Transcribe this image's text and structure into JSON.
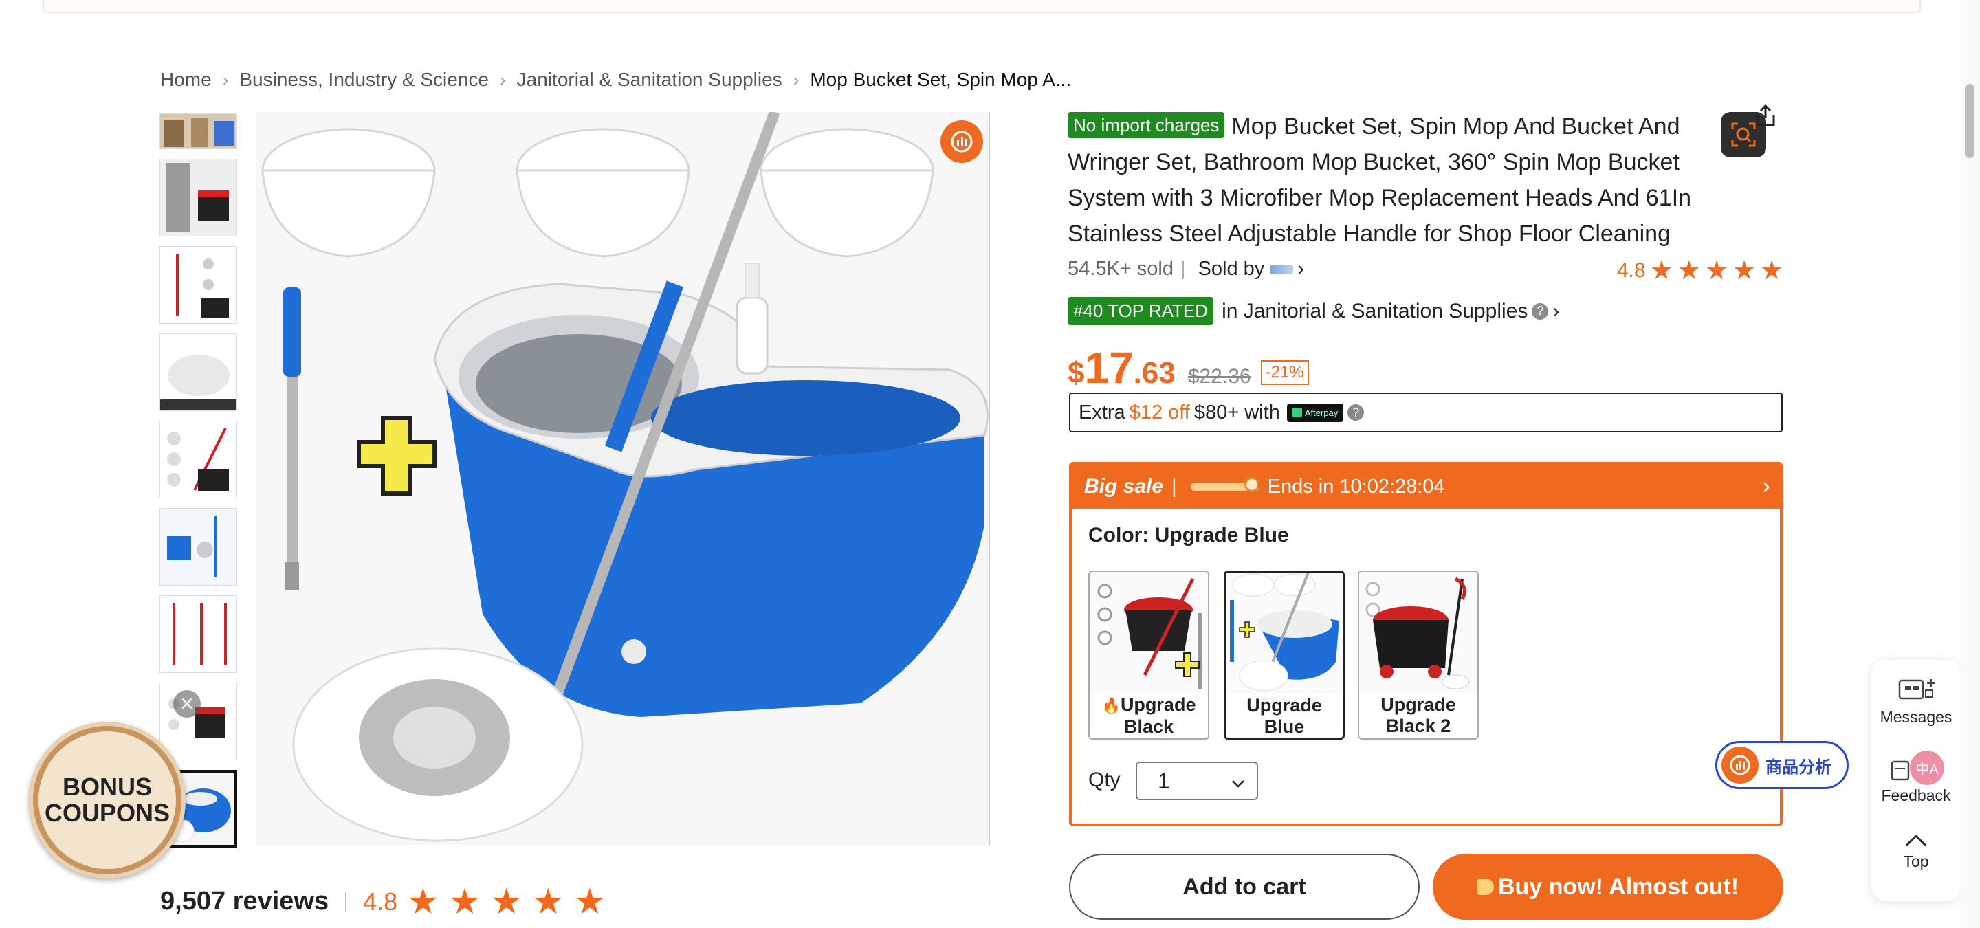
{
  "breadcrumb": [
    {
      "label": "Home"
    },
    {
      "label": "Business, Industry & Science"
    },
    {
      "label": "Janitorial & Sanitation Supplies"
    },
    {
      "label": "Mop Bucket Set, Spin Mop A..."
    }
  ],
  "product": {
    "badge_no_import": "No import charges",
    "title": "Mop Bucket Set, Spin Mop And Bucket And Wringer Set, Bathroom Mop Bucket, 360° Spin Mop Bucket System with 3 Microfiber Mop Replacement Heads And 61In Stainless Steel Adjustable Handle for Shop Floor Cleaning",
    "sold": "54.5K+ sold",
    "sold_by_label": "Sold by",
    "rating": "4.8",
    "top_rated_badge": "#40 TOP RATED",
    "top_rated_category": "in Janitorial & Sanitation Supplies",
    "price": {
      "currency": "$",
      "integer": "17",
      "decimal": ".63",
      "original": "$22.36",
      "discount": "-21%"
    },
    "afterpay": {
      "extra": "Extra",
      "amount": "$12 off",
      "threshold": "$80+ with",
      "logo_text": "Afterpay"
    },
    "sale": {
      "label": "Big sale",
      "countdown": "Ends in 10:02:28:04"
    },
    "color_label": "Color: Upgrade Blue",
    "color_options": [
      {
        "label": "Upgrade Black",
        "selected": false
      },
      {
        "label": "Upgrade Blue",
        "selected": true
      },
      {
        "label": "Upgrade Black 2",
        "selected": false
      }
    ],
    "qty_label": "Qty",
    "qty_value": "1",
    "add_to_cart": "Add to cart",
    "buy_now": "Buy now! Almost out!"
  },
  "reviews": {
    "count": "9,507 reviews",
    "rating": "4.8",
    "stars": 5
  },
  "bonus_coupons": "BONUS COUPONS",
  "analysis_button": "商品分析",
  "side_panel": {
    "messages": "Messages",
    "feedback": "Feedback",
    "top": "Top"
  },
  "colors": {
    "accent": "#ef6a1f",
    "green_badge": "#1f8a1f",
    "bucket_blue": "#1f6ed8"
  }
}
